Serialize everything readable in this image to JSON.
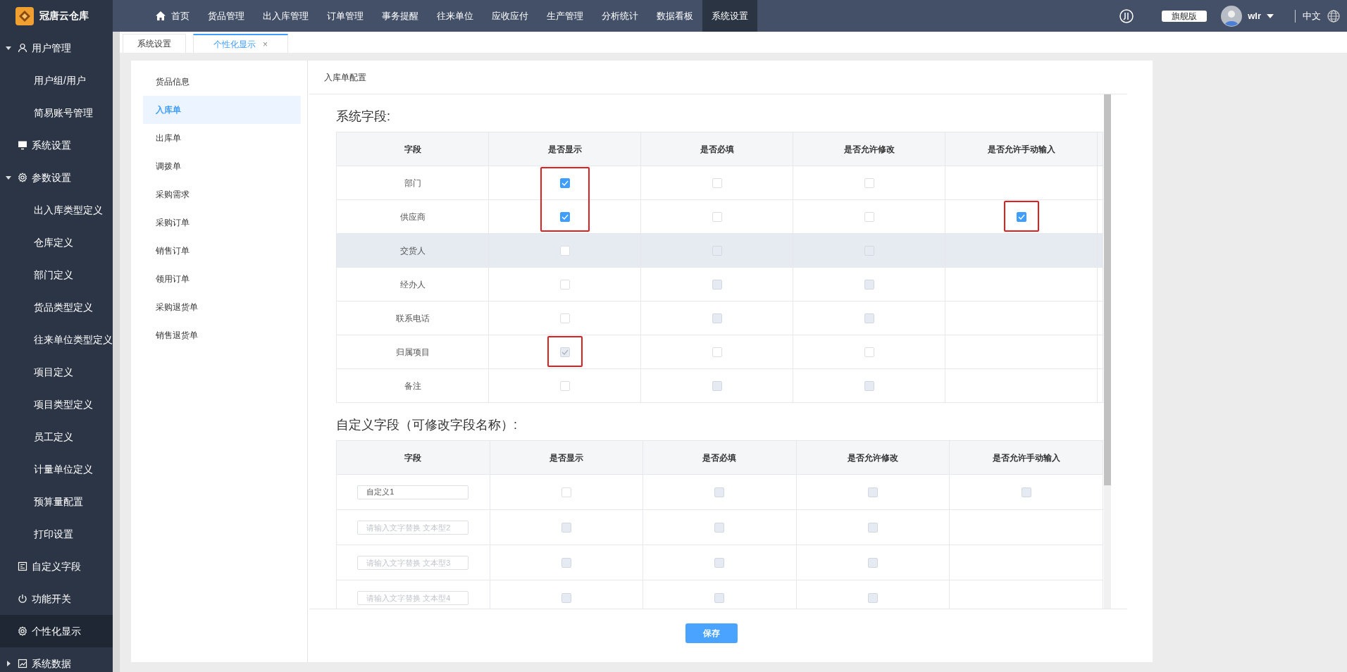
{
  "app": {
    "title": "冠唐云仓库"
  },
  "top_nav": [
    {
      "label": "首页",
      "kind": "home",
      "selected": false
    },
    {
      "label": "货品管理",
      "kind": "plain",
      "selected": false
    },
    {
      "label": "出入库管理",
      "kind": "plain",
      "selected": false
    },
    {
      "label": "订单管理",
      "kind": "plain",
      "selected": false
    },
    {
      "label": "事务提醒",
      "kind": "plain",
      "selected": false
    },
    {
      "label": "往来单位",
      "kind": "plain",
      "selected": false
    },
    {
      "label": "应收应付",
      "kind": "plain",
      "selected": false
    },
    {
      "label": "生产管理",
      "kind": "plain",
      "selected": false
    },
    {
      "label": "分析统计",
      "kind": "plain",
      "selected": false
    },
    {
      "label": "数据看板",
      "kind": "plain",
      "selected": false
    },
    {
      "label": "系统设置",
      "kind": "plain",
      "selected": true
    }
  ],
  "header_right": {
    "edition": "旗舰版",
    "user": "wlr",
    "language": "中文"
  },
  "sidebar": [
    {
      "label": "用户管理",
      "kind": "user",
      "expanded": true,
      "selected": false,
      "children": [
        {
          "label": "用户组/用户",
          "selected": false
        },
        {
          "label": "简易账号管理",
          "selected": false
        }
      ]
    },
    {
      "label": "系统设置",
      "kind": "monitor",
      "selected": false
    },
    {
      "label": "参数设置",
      "kind": "gear",
      "expanded": true,
      "selected": false,
      "children": [
        {
          "label": "出入库类型定义",
          "selected": false
        },
        {
          "label": "仓库定义",
          "selected": false
        },
        {
          "label": "部门定义",
          "selected": false
        },
        {
          "label": "货品类型定义",
          "selected": false
        },
        {
          "label": "往来单位类型定义",
          "selected": false
        },
        {
          "label": "项目定义",
          "selected": false
        },
        {
          "label": "项目类型定义",
          "selected": false
        },
        {
          "label": "员工定义",
          "selected": false
        },
        {
          "label": "计量单位定义",
          "selected": false
        },
        {
          "label": "预算量配置",
          "selected": false
        },
        {
          "label": "打印设置",
          "selected": false
        }
      ]
    },
    {
      "label": "自定义字段",
      "kind": "form",
      "selected": false
    },
    {
      "label": "功能开关",
      "kind": "power",
      "selected": false
    },
    {
      "label": "个性化显示",
      "kind": "gear",
      "selected": true
    },
    {
      "label": "系统数据",
      "kind": "chart",
      "expanded": false,
      "selected": false
    }
  ],
  "tabs": [
    {
      "label": "系统设置",
      "selected": false
    },
    {
      "label": "个性化显示",
      "selected": true,
      "close": "×"
    }
  ],
  "config_menu": [
    {
      "label": "货品信息",
      "selected": false
    },
    {
      "label": "入库单",
      "selected": true
    },
    {
      "label": "出库单",
      "selected": false
    },
    {
      "label": "调拨单",
      "selected": false
    },
    {
      "label": "采购需求",
      "selected": false
    },
    {
      "label": "采购订单",
      "selected": false
    },
    {
      "label": "销售订单",
      "selected": false
    },
    {
      "label": "领用订单",
      "selected": false
    },
    {
      "label": "采购退货单",
      "selected": false
    },
    {
      "label": "销售退货单",
      "selected": false
    }
  ],
  "panel_title": "入库单配置",
  "system_fields": {
    "heading": "系统字段:",
    "columns": [
      "字段",
      "是否显示",
      "是否必填",
      "是否允许修改",
      "是否允许手动输入"
    ],
    "rows": [
      {
        "field": "部门",
        "hovered": false,
        "cells": [
          {
            "checked": true,
            "disabled": false,
            "highlight": true
          },
          {
            "checked": false,
            "disabled": false
          },
          {
            "checked": false,
            "disabled": false
          },
          null
        ]
      },
      {
        "field": "供应商",
        "hovered": false,
        "cells": [
          {
            "checked": true,
            "disabled": false,
            "highlight": true
          },
          {
            "checked": false,
            "disabled": false
          },
          {
            "checked": false,
            "disabled": false
          },
          {
            "checked": true,
            "disabled": false,
            "highlight": true
          }
        ]
      },
      {
        "field": "交货人",
        "hovered": true,
        "cells": [
          {
            "checked": false,
            "disabled": false
          },
          {
            "checked": false,
            "disabled": true
          },
          {
            "checked": false,
            "disabled": true
          },
          null
        ]
      },
      {
        "field": "经办人",
        "hovered": false,
        "cells": [
          {
            "checked": false,
            "disabled": false
          },
          {
            "checked": false,
            "disabled": true
          },
          {
            "checked": false,
            "disabled": true
          },
          null
        ]
      },
      {
        "field": "联系电话",
        "hovered": false,
        "cells": [
          {
            "checked": false,
            "disabled": false
          },
          {
            "checked": false,
            "disabled": true
          },
          {
            "checked": false,
            "disabled": true
          },
          null
        ]
      },
      {
        "field": "归属项目",
        "hovered": false,
        "cells": [
          {
            "checked": true,
            "disabled": true,
            "highlight": true
          },
          {
            "checked": false,
            "disabled": false
          },
          {
            "checked": false,
            "disabled": false
          },
          null
        ]
      },
      {
        "field": "备注",
        "hovered": false,
        "cells": [
          {
            "checked": false,
            "disabled": false
          },
          {
            "checked": false,
            "disabled": true
          },
          {
            "checked": false,
            "disabled": true
          },
          null
        ]
      }
    ]
  },
  "custom_fields": {
    "heading": "自定义字段（可修改字段名称）:",
    "columns": [
      "字段",
      "是否显示",
      "是否必填",
      "是否允许修改",
      "是否允许手动输入"
    ],
    "rows": [
      {
        "input": {
          "value": "自定义1"
        },
        "cells": [
          {
            "checked": false,
            "disabled": false
          },
          {
            "checked": false,
            "disabled": true
          },
          {
            "checked": false,
            "disabled": true
          },
          {
            "checked": false,
            "disabled": true
          }
        ]
      },
      {
        "input": {
          "placeholder": "请输入文字替换 文本型2"
        },
        "cells": [
          {
            "checked": false,
            "disabled": true
          },
          {
            "checked": false,
            "disabled": true
          },
          {
            "checked": false,
            "disabled": true
          },
          null
        ]
      },
      {
        "input": {
          "placeholder": "请输入文字替换 文本型3"
        },
        "cells": [
          {
            "checked": false,
            "disabled": true
          },
          {
            "checked": false,
            "disabled": true
          },
          {
            "checked": false,
            "disabled": true
          },
          null
        ]
      },
      {
        "input": {
          "placeholder": "请输入文字替换 文本型4"
        },
        "cells": [
          {
            "checked": false,
            "disabled": true
          },
          {
            "checked": false,
            "disabled": true
          },
          {
            "checked": false,
            "disabled": true
          },
          null
        ]
      }
    ]
  },
  "save_button": "保存"
}
